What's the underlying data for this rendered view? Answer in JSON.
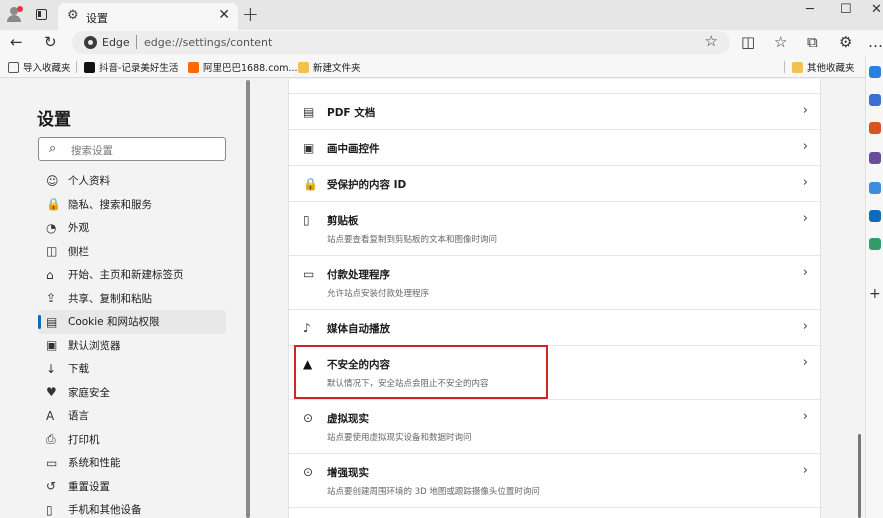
{
  "browser": {
    "tab": {
      "icon": "gear-icon",
      "title": "设置",
      "close": "✕"
    },
    "new_tab": "+",
    "window": {
      "minimize": "─",
      "maximize": "☐",
      "close": "✕"
    },
    "address": {
      "site_label": "Edge",
      "url": "edge://settings/content"
    },
    "nav_icons": {
      "back": "←",
      "refresh": "↻",
      "favorite": "☆",
      "split": "◫",
      "favorites": "☆",
      "collections": "⧉",
      "extensions": "⚙",
      "more": "…"
    }
  },
  "bookmarks": [
    {
      "label": "导入收藏夹",
      "icon": "import-icon"
    },
    {
      "label": "抖音-记录美好生活",
      "icon": "douyin-icon"
    },
    {
      "label": "阿里巴巴1688.com...",
      "icon": "alibaba-icon"
    },
    {
      "label": "新建文件夹",
      "icon": "folder-icon"
    },
    {
      "label": "其他收藏夹",
      "icon": "folder-icon"
    }
  ],
  "sidebar": {
    "title": "设置",
    "search_placeholder": "搜索设置",
    "items": [
      {
        "label": "个人资料",
        "icon": "☺"
      },
      {
        "label": "隐私、搜索和服务",
        "icon": "🔒"
      },
      {
        "label": "外观",
        "icon": "◔"
      },
      {
        "label": "侧栏",
        "icon": "◫"
      },
      {
        "label": "开始、主页和新建标签页",
        "icon": "⌂"
      },
      {
        "label": "共享、复制和粘贴",
        "icon": "⇪"
      },
      {
        "label": "Cookie 和网站权限",
        "icon": "▤",
        "active": true
      },
      {
        "label": "默认浏览器",
        "icon": "▣"
      },
      {
        "label": "下载",
        "icon": "↓"
      },
      {
        "label": "家庭安全",
        "icon": "♥"
      },
      {
        "label": "语言",
        "icon": "A"
      },
      {
        "label": "打印机",
        "icon": "⎙"
      },
      {
        "label": "系统和性能",
        "icon": "▭"
      },
      {
        "label": "重置设置",
        "icon": "↺"
      },
      {
        "label": "手机和其他设备",
        "icon": "▯"
      }
    ]
  },
  "content": {
    "rows": [
      {
        "title": "PDF 文档",
        "desc": "",
        "icon": "▤"
      },
      {
        "title": "画中画控件",
        "desc": "",
        "icon": "▣"
      },
      {
        "title": "受保护的内容 ID",
        "desc": "",
        "icon": "🔒"
      },
      {
        "title": "剪贴板",
        "desc": "站点要查看复制到剪贴板的文本和图像时询问",
        "icon": "▯"
      },
      {
        "title": "付款处理程序",
        "desc": "允许站点安装付款处理程序",
        "icon": "▭"
      },
      {
        "title": "媒体自动播放",
        "desc": "",
        "icon": "♪"
      },
      {
        "title": "不安全的内容",
        "desc": "默认情况下，安全站点会阻止不安全的内容",
        "icon": "▲"
      },
      {
        "title": "虚拟现实",
        "desc": "站点要使用虚拟现实设备和数据时询问",
        "icon": "⊙"
      },
      {
        "title": "增强现实",
        "desc": "站点要创建周围环境的 3D 地图或跟踪摄像头位置时询问",
        "icon": "⊙"
      }
    ],
    "chevron": "›"
  }
}
